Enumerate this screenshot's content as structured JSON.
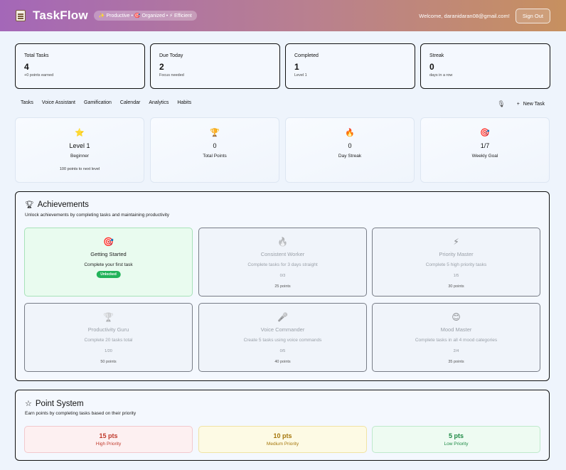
{
  "header": {
    "title": "TaskFlow",
    "tagline": "✨ Productive • 🎯 Organized • ⚡ Efficient",
    "welcome": "Welcome, daranidaran08@gmail.com!",
    "signout_label": "Sign Out",
    "gradient_colors": [
      "#a467b8",
      "#c7905f"
    ]
  },
  "stats": [
    {
      "label": "Total Tasks",
      "value": "4",
      "sub": "+0 points earned"
    },
    {
      "label": "Due Today",
      "value": "2",
      "sub": "Focus needed"
    },
    {
      "label": "Completed",
      "value": "1",
      "sub": "Level 1"
    },
    {
      "label": "Streak",
      "value": "0",
      "sub": "days in a row"
    }
  ],
  "nav": {
    "tabs": [
      "Tasks",
      "Voice Assistant",
      "Gamification",
      "Calendar",
      "Analytics",
      "Habits"
    ],
    "new_task_label": "New Task"
  },
  "gamification": [
    {
      "icon": "⭐",
      "value": "Level 1",
      "label": "Beginner",
      "note": "100 points to next level"
    },
    {
      "icon": "🏆",
      "value": "0",
      "label": "Total Points"
    },
    {
      "icon": "🔥",
      "value": "0",
      "label": "Day Streak"
    },
    {
      "icon": "🎯",
      "value": "1/7",
      "label": "Weekly Goal"
    }
  ],
  "achievements": {
    "title": "Achievements",
    "description": "Unlock achievements by completing tasks and maintaining productivity",
    "items": [
      {
        "icon": "🎯",
        "name": "Getting Started",
        "desc": "Complete your first task",
        "badge": "Unlocked",
        "unlocked": true
      },
      {
        "icon": "🔥",
        "name": "Consistent Worker",
        "desc": "Complete tasks for 3 days straight",
        "progress": "0/3",
        "points": "25 points",
        "unlocked": false
      },
      {
        "icon": "⚡",
        "name": "Priority Master",
        "desc": "Complete 5 high priority tasks",
        "progress": "1/5",
        "points": "30 points",
        "unlocked": false
      },
      {
        "icon": "🏆",
        "name": "Productivity Guru",
        "desc": "Complete 20 tasks total",
        "progress": "1/20",
        "points": "50 points",
        "unlocked": false
      },
      {
        "icon": "🎤",
        "name": "Voice Commander",
        "desc": "Create 5 tasks using voice commands",
        "progress": "0/5",
        "points": "40 points",
        "unlocked": false
      },
      {
        "icon": "😊",
        "name": "Mood Master",
        "desc": "Complete tasks in all 4 mood categories",
        "progress": "2/4",
        "points": "35 points",
        "unlocked": false
      }
    ]
  },
  "point_system": {
    "title": "Point System",
    "description": "Earn points by completing tasks based on their priority",
    "items": [
      {
        "value": "15 pts",
        "label": "High Priority",
        "color": "#c0392b",
        "bg": "#fdf0f1",
        "border": "#f2c9cd"
      },
      {
        "value": "10 pts",
        "label": "Medium Priority",
        "color": "#a5760a",
        "bg": "#fdfae4",
        "border": "#f0e3a4"
      },
      {
        "value": "5 pts",
        "label": "Low Priority",
        "color": "#1e8a45",
        "bg": "#eefbf2",
        "border": "#bfe9cc"
      }
    ]
  }
}
